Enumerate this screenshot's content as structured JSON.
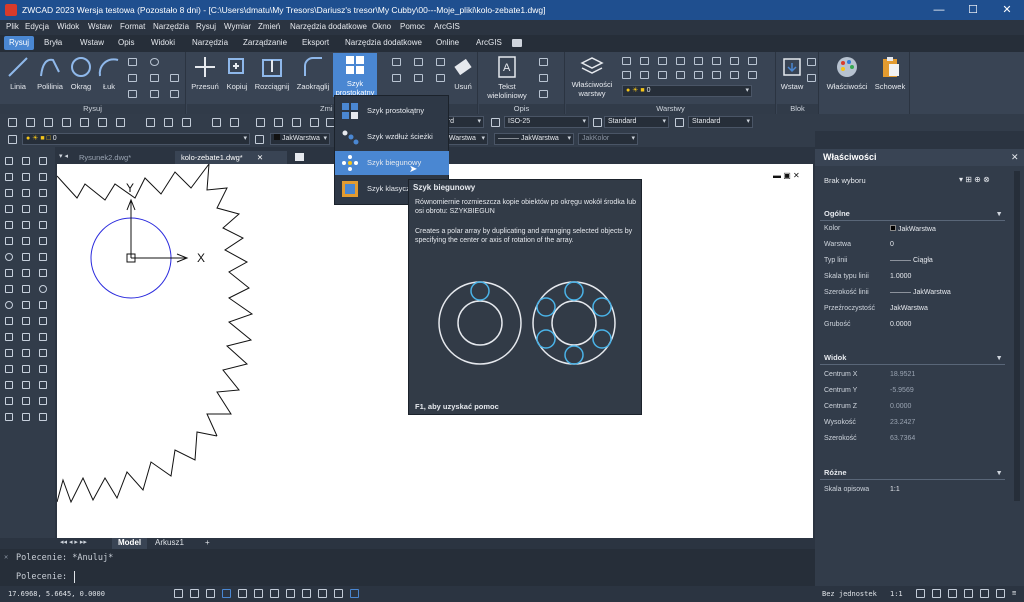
{
  "titlebar": {
    "title": "ZWCAD 2023 Wersja testowa (Pozostało 8 dni) - [C:\\Users\\dmatu\\My Tresors\\Dariusz's tresor\\My Cubby\\00---Moje_pliki\\kolo-zebate1.dwg]"
  },
  "menu": [
    "Plik",
    "Edycja",
    "Widok",
    "Wstaw",
    "Format",
    "Narzędzia",
    "Rysuj",
    "Wymiar",
    "Zmień",
    "Narzędzia dodatkowe",
    "Okno",
    "Pomoc",
    "ArcGIS"
  ],
  "ribbon_tabs": [
    "Rysuj",
    "Bryła",
    "Wstaw",
    "Opis",
    "Widoki",
    "Narzędzia",
    "Zarządzanie",
    "Eksport",
    "Narzędzia dodatkowe",
    "Online",
    "ArcGIS"
  ],
  "ribbon": {
    "draw": {
      "label": "Rysuj",
      "linia": "Linia",
      "polilinia": "Polilinia",
      "okrag": "Okrąg",
      "luk": "Łuk"
    },
    "modify": {
      "label": "Zmi",
      "przesun": "Przesuń",
      "kopiuj": "Kopiuj",
      "rozciagnij": "Rozciągnij",
      "zaokraglij": "Zaokrąglij",
      "szyk1": "Szyk",
      "szyk2": "prostokątny",
      "usun": "Usuń"
    },
    "annot": {
      "label": "Opis",
      "tekst1": "Tekst",
      "tekst2": "wieloliniowy",
      "layer_val": "0"
    },
    "layers": {
      "label": "Warstwy",
      "wlasc1": "Właściwości",
      "wlasc2": "warstwy"
    },
    "block": {
      "label": "Blok",
      "wstaw": "Wstaw"
    },
    "right": {
      "wlasciwosci": "Właściwości",
      "schowek": "Schowek"
    }
  },
  "toolbar2": {
    "layer": "0",
    "style1": "ISO-25",
    "style2": "Standard",
    "style3": "Standard",
    "text_style": "dard"
  },
  "toolbar3": {
    "color": "JakWarstwa",
    "linetype": "JakWarstwa",
    "lineweight": "JakWarstwa",
    "plotstyle": "JakKolor"
  },
  "doc_tabs": [
    "Rysunek2.dwg*",
    "kolo-zebate1.dwg*"
  ],
  "dropdown": [
    "Szyk prostokątny",
    "Szyk wzdłuż ścieżki",
    "Szyk biegunowy",
    "Szyk klasyczny"
  ],
  "tooltip": {
    "title": "Szyk biegunowy",
    "desc_pl": "Równomiernie rozmieszcza kopie obiektów po okręgu wokół środka lub osi obrotu: SZYKBIEGUN",
    "desc_en": "Creates a polar array by duplicating and arranging selected objects by specifying the center or axis of rotation of the array.",
    "help": "F1, aby uzyskać pomoc"
  },
  "ucs": {
    "x": "X",
    "y": "Y"
  },
  "model_tabs": [
    "Model",
    "Arkusz1",
    "+"
  ],
  "command": {
    "line1": "Polecenie: *Anuluj*",
    "line2": "Polecenie:"
  },
  "status": {
    "coords": "17.6968, 5.6645, 0.0000",
    "units": "Bez jednostek",
    "scale": "1:1"
  },
  "properties": {
    "title": "Właściwości",
    "selection": "Brak wyboru",
    "general": {
      "section": "Ogólne",
      "rows": [
        [
          "Kolor",
          "JakWarstwa"
        ],
        [
          "Warstwa",
          "0"
        ],
        [
          "Typ linii",
          "Ciągła"
        ],
        [
          "Skala typu linii",
          "1.0000"
        ],
        [
          "Szerokość linii",
          "JakWarstwa"
        ],
        [
          "Przeźroczystość",
          "JakWarstwa"
        ],
        [
          "Grubość",
          "0.0000"
        ]
      ]
    },
    "view": {
      "section": "Widok",
      "rows": [
        [
          "Centrum X",
          "18.9521"
        ],
        [
          "Centrum Y",
          "-5.9569"
        ],
        [
          "Centrum Z",
          "0.0000"
        ],
        [
          "Wysokość",
          "23.2427"
        ],
        [
          "Szerokość",
          "63.7364"
        ]
      ]
    },
    "misc": {
      "section": "Różne",
      "rows": [
        [
          "Skala opisowa",
          "1:1"
        ]
      ]
    }
  },
  "colors": {
    "accent": "#4a87d2",
    "title_bg": "#1f4f8f",
    "panel": "#394454"
  }
}
